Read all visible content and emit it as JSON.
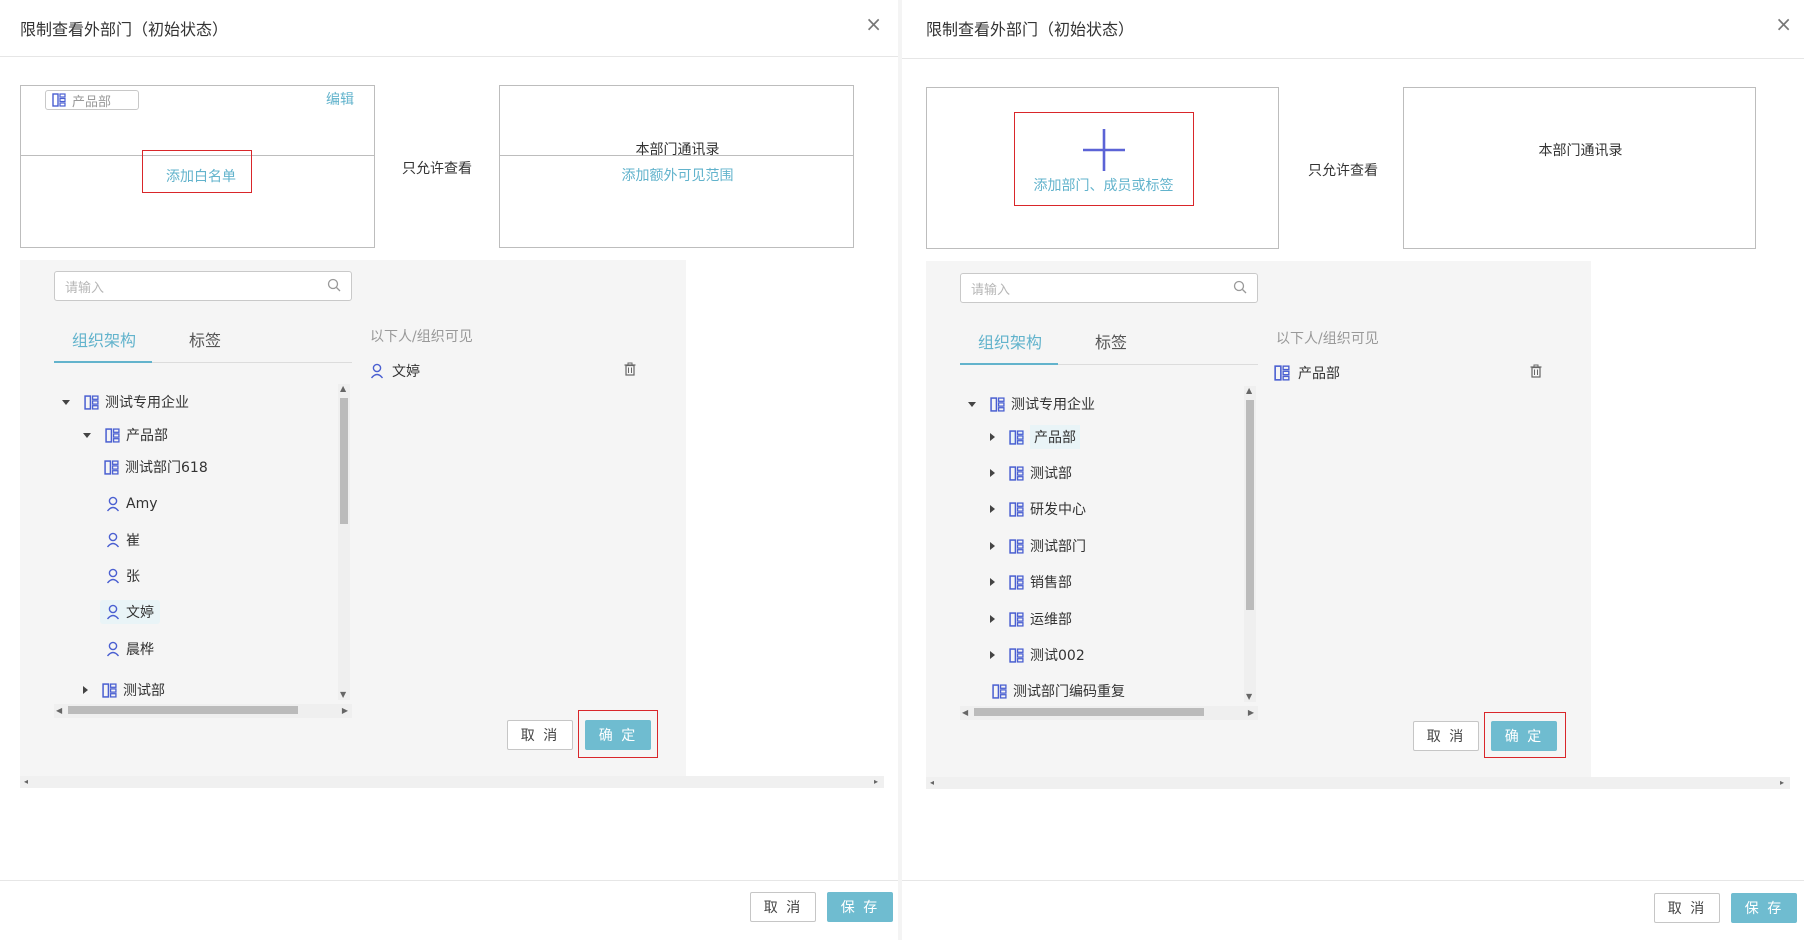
{
  "left": {
    "title": "限制查看外部门（初始状态）",
    "close": "×",
    "chip_label": "产品部",
    "edit_link": "编辑",
    "add_whitelist": "添加白名单",
    "only_allow": "只允许查看",
    "dept_contacts": "本部门通讯录",
    "add_extra_scope": "添加额外可见范围",
    "search_placeholder": "请输入",
    "tab_org": "组织架构",
    "tab_tags": "标签",
    "tree": [
      {
        "label": "测试专用企业",
        "icon": "department-icon",
        "caret": "down"
      },
      {
        "label": "产品部",
        "icon": "department-icon",
        "caret": "down"
      },
      {
        "label": "测试部门618",
        "icon": "department-icon",
        "caret": "none"
      },
      {
        "label": "Amy",
        "icon": "user-icon",
        "caret": "none"
      },
      {
        "label": "崔",
        "icon": "user-icon",
        "caret": "none"
      },
      {
        "label": "张",
        "icon": "user-icon",
        "caret": "none"
      },
      {
        "label": "文婷",
        "icon": "user-icon",
        "caret": "none"
      },
      {
        "label": "晨桦",
        "icon": "user-icon",
        "caret": "none"
      },
      {
        "label": "测试部",
        "icon": "department-icon",
        "caret": "right"
      }
    ],
    "selected_title": "以下人/组织可见",
    "selected_item": "文婷",
    "cancel": "取 消",
    "confirm": "确 定",
    "footer_cancel": "取 消",
    "footer_save": "保 存"
  },
  "right": {
    "title": "限制查看外部门（初始状态）",
    "close": "×",
    "add_label": "添加部门、成员或标签",
    "only_allow": "只允许查看",
    "dept_contacts": "本部门通讯录",
    "search_placeholder": "请输入",
    "tab_org": "组织架构",
    "tab_tags": "标签",
    "tree": [
      {
        "label": "测试专用企业",
        "icon": "department-icon",
        "caret": "down"
      },
      {
        "label": "产品部",
        "icon": "department-icon",
        "caret": "right"
      },
      {
        "label": "测试部",
        "icon": "department-icon",
        "caret": "right"
      },
      {
        "label": "研发中心",
        "icon": "department-icon",
        "caret": "right"
      },
      {
        "label": "测试部门",
        "icon": "department-icon",
        "caret": "right"
      },
      {
        "label": "销售部",
        "icon": "department-icon",
        "caret": "right"
      },
      {
        "label": "运维部",
        "icon": "department-icon",
        "caret": "right"
      },
      {
        "label": "测试002",
        "icon": "department-icon",
        "caret": "right"
      },
      {
        "label": "测试部门编码重复",
        "icon": "department-icon",
        "caret": "none"
      }
    ],
    "selected_title": "以下人/组织可见",
    "selected_item": "产品部",
    "cancel": "取 消",
    "confirm": "确 定",
    "footer_cancel": "取 消",
    "footer_save": "保 存"
  },
  "colors": {
    "accent": "#62b3cc",
    "primary_button": "#6fbcd0",
    "highlight_frame": "#d9262a",
    "icon_blue": "#4a5fd1"
  }
}
